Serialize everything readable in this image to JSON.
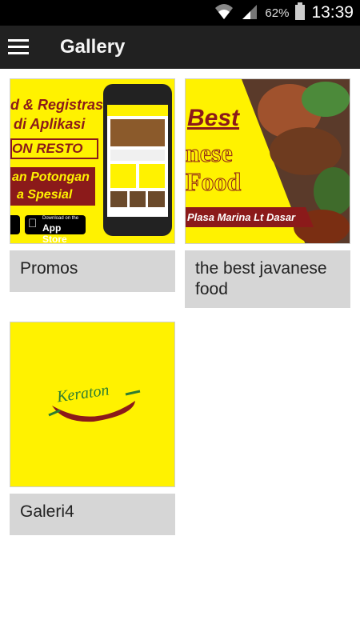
{
  "status": {
    "battery": "62%",
    "time": "13:39"
  },
  "appbar": {
    "title": "Gallery"
  },
  "items": [
    {
      "caption": "Promos",
      "poster": {
        "line1": "d & Registrasi",
        "line2": "di Aplikasi",
        "brand": "ON RESTO",
        "promo1": "an Potongan",
        "promo2": "a Spesial",
        "store_small": "Download on the",
        "store": "App Store"
      }
    },
    {
      "caption": "the best javanese food",
      "poster": {
        "best": "Best",
        "w1": "nese",
        "w2": "Food",
        "place": "Plasa Marina Lt Dasar"
      }
    },
    {
      "caption": "Galeri4",
      "poster": {
        "logo": "Keraton"
      }
    }
  ],
  "colors": {
    "yellow": "#fff200",
    "maroon": "#8b1a1a",
    "caption_bg": "#d6d6d6",
    "appbar": "#212121"
  }
}
